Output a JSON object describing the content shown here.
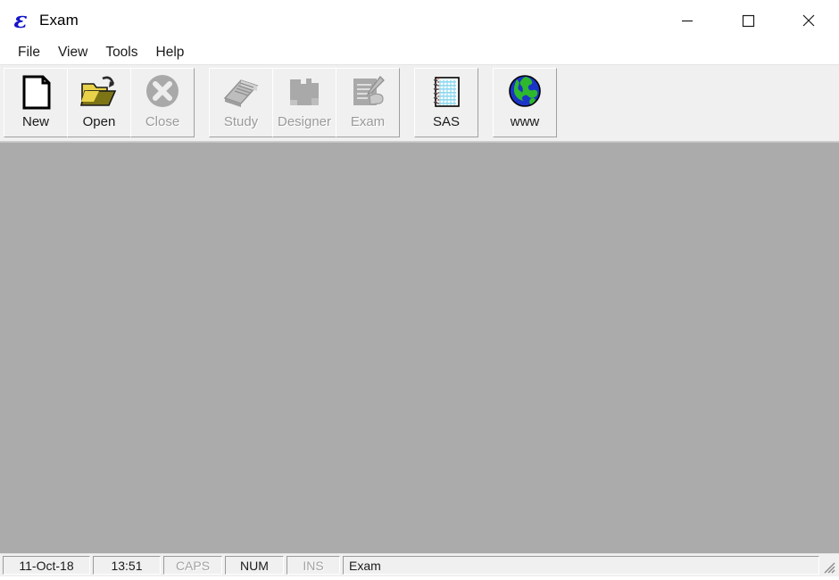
{
  "window": {
    "title": "Exam",
    "logo_icon": "script-e-logo",
    "logo_color": "#1414c8",
    "controls": [
      {
        "name": "minimize",
        "icon": "minimize-icon",
        "label": "–"
      },
      {
        "name": "maximize",
        "icon": "maximize-icon",
        "label": "□"
      },
      {
        "name": "close",
        "icon": "close-icon",
        "label": "✕"
      }
    ]
  },
  "menu": {
    "items": [
      {
        "label": "File"
      },
      {
        "label": "View"
      },
      {
        "label": "Tools"
      },
      {
        "label": "Help"
      }
    ]
  },
  "toolbar": {
    "groups": [
      {
        "buttons": [
          {
            "label": "New",
            "icon": "new-document-icon",
            "enabled": true
          },
          {
            "label": "Open",
            "icon": "open-folder-icon",
            "enabled": true
          },
          {
            "label": "Close",
            "icon": "close-circle-icon",
            "enabled": false
          }
        ]
      },
      {
        "buttons": [
          {
            "label": "Study",
            "icon": "study-book-icon",
            "enabled": false
          },
          {
            "label": "Designer",
            "icon": "designer-icon",
            "enabled": false
          },
          {
            "label": "Exam",
            "icon": "exam-writing-icon",
            "enabled": false
          }
        ]
      },
      {
        "buttons": [
          {
            "label": "SAS",
            "icon": "notebook-icon",
            "enabled": true
          }
        ]
      },
      {
        "buttons": [
          {
            "label": "www",
            "icon": "globe-icon",
            "enabled": true
          }
        ]
      }
    ]
  },
  "client": {
    "background_color": "#ababab"
  },
  "status_bar": {
    "date": "11-Oct-18",
    "time": "13:51",
    "caps": "CAPS",
    "caps_active": false,
    "num": "NUM",
    "num_active": true,
    "ins": "INS",
    "ins_active": false,
    "message": "Exam",
    "grip_icon": "resize-grip-icon"
  }
}
